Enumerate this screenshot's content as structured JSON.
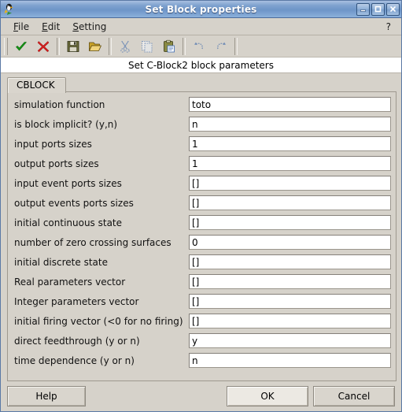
{
  "window": {
    "title": "Set Block properties",
    "icon": "scilab-penguin-icon",
    "controls": {
      "minimize": "minimize-icon",
      "maximize": "maximize-icon",
      "close": "close-icon"
    }
  },
  "menubar": {
    "items": [
      {
        "label": "File",
        "mnemonic": "F"
      },
      {
        "label": "Edit",
        "mnemonic": "E"
      },
      {
        "label": "Setting",
        "mnemonic": "S"
      }
    ],
    "help": "?"
  },
  "toolbar": {
    "buttons": [
      {
        "name": "ok-check-icon",
        "title": "Ok"
      },
      {
        "name": "cancel-cross-icon",
        "title": "Cancel"
      },
      {
        "name": "save-floppy-icon",
        "title": "Save"
      },
      {
        "name": "open-folder-icon",
        "title": "Open"
      },
      {
        "name": "cut-scissors-icon",
        "title": "Cut"
      },
      {
        "name": "copy-icon",
        "title": "Copy"
      },
      {
        "name": "paste-clipboard-icon",
        "title": "Paste"
      },
      {
        "name": "undo-arrow-icon",
        "title": "Undo"
      },
      {
        "name": "redo-arrow-icon",
        "title": "Redo"
      }
    ]
  },
  "caption": "Set C-Block2 block parameters",
  "tabs": [
    {
      "label": "CBLOCK",
      "active": true
    }
  ],
  "form": {
    "rows": [
      {
        "label": "simulation function",
        "value": "toto"
      },
      {
        "label": "is block implicit? (y,n)",
        "value": "n"
      },
      {
        "label": "input ports sizes",
        "value": "1"
      },
      {
        "label": "output ports sizes",
        "value": "1"
      },
      {
        "label": "input event ports sizes",
        "value": "[]"
      },
      {
        "label": "output events ports sizes",
        "value": "[]"
      },
      {
        "label": "initial continuous state",
        "value": "[]"
      },
      {
        "label": "number of zero crossing surfaces",
        "value": "0"
      },
      {
        "label": "initial discrete state",
        "value": "[]"
      },
      {
        "label": "Real parameters vector",
        "value": "[]"
      },
      {
        "label": "Integer parameters vector",
        "value": "[]"
      },
      {
        "label": "initial firing vector (<0 for no firing)",
        "value": "[]"
      },
      {
        "label": "direct feedthrough (y or n)",
        "value": "y"
      },
      {
        "label": "time dependence (y or n)",
        "value": "n"
      }
    ]
  },
  "buttons": {
    "help": "Help",
    "ok": "OK",
    "cancel": "Cancel"
  },
  "colors": {
    "title_bar_blue": "#7fa2cf",
    "window_face": "#d6d2ca",
    "field_background": "#ffffff",
    "accent_green": "#1e9e1e",
    "accent_red": "#d41f1f"
  }
}
